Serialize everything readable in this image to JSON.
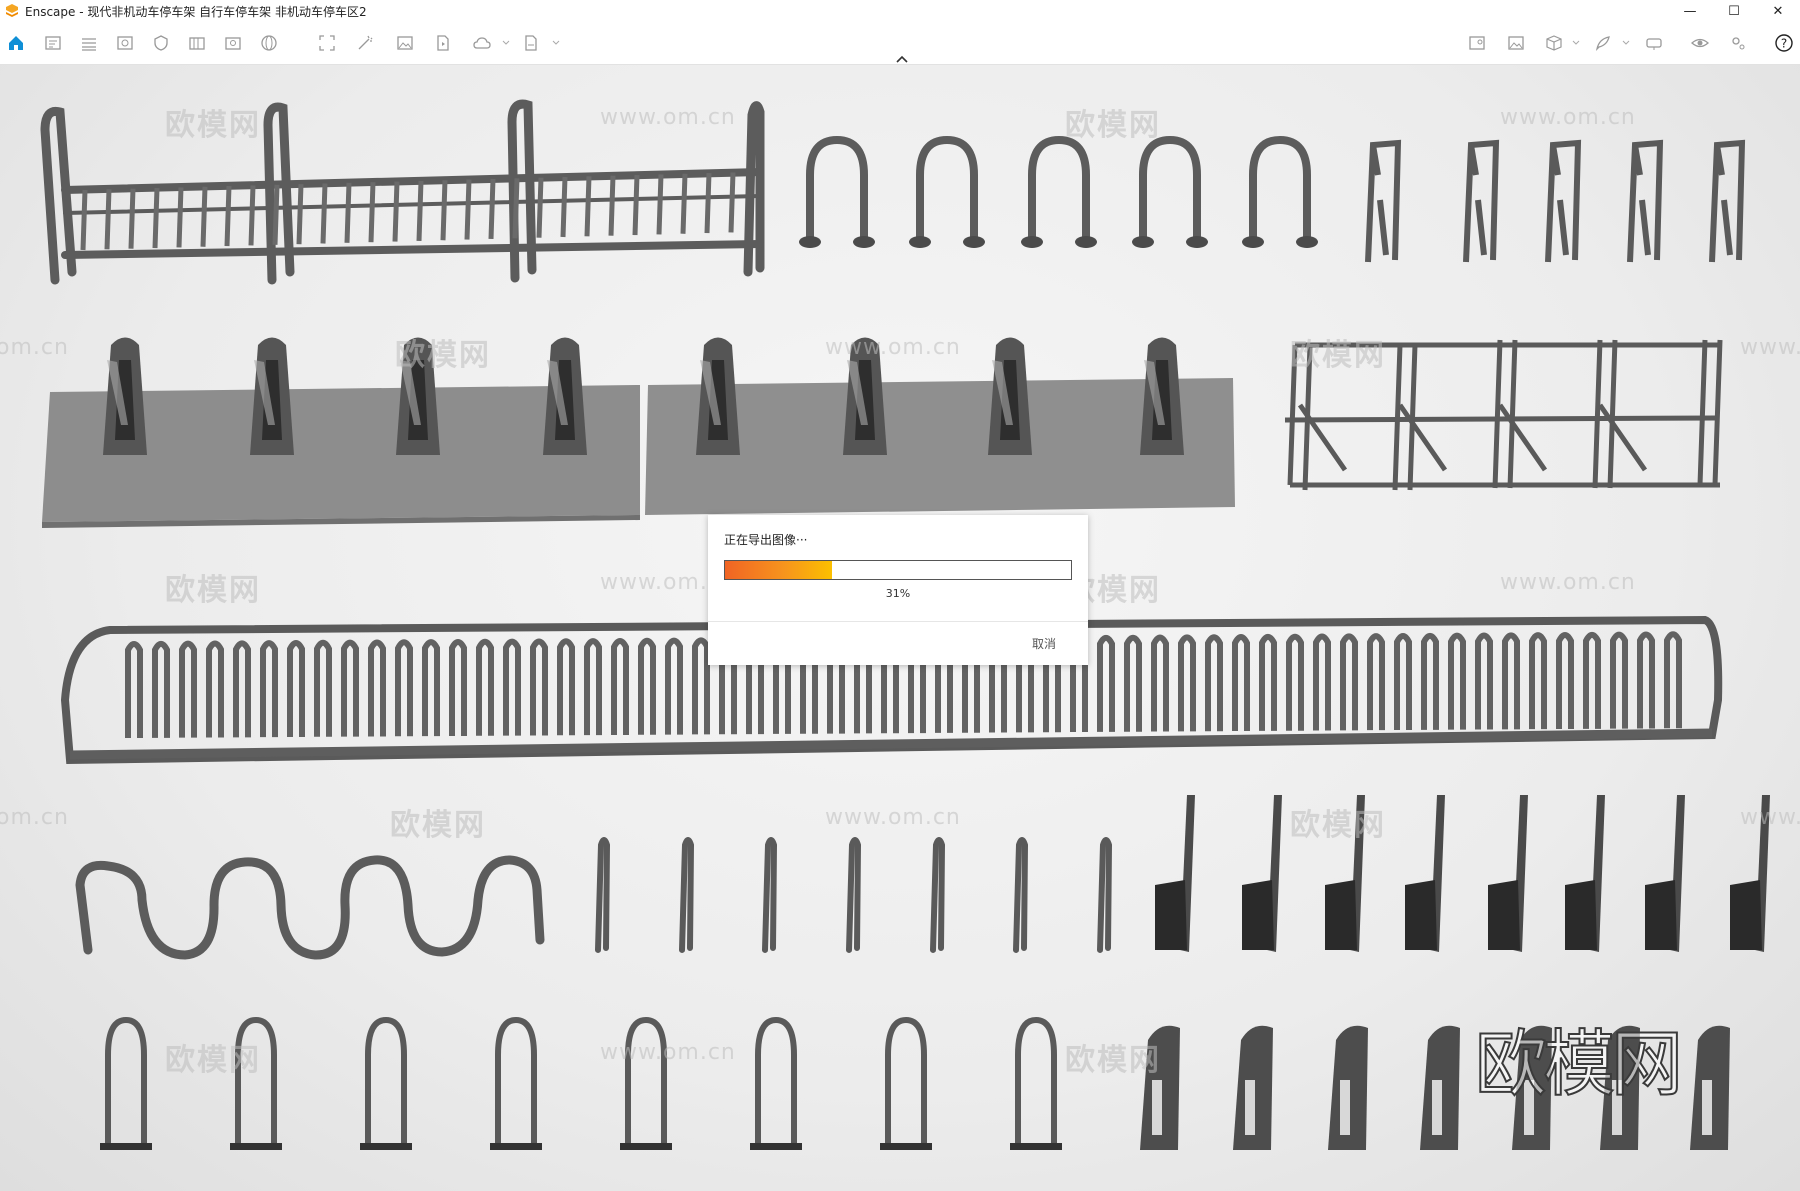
{
  "window": {
    "title": "Enscape - 现代非机动车停车架 自行车停车架 非机动车停车区2",
    "minimize_glyph": "—",
    "maximize_glyph": "☐",
    "close_glyph": "✕"
  },
  "toolbar": {
    "left_icons": [
      "home-icon",
      "screenshot-icon",
      "texture-icon",
      "eye-view-icon",
      "shield-icon",
      "batch-render-icon",
      "camera-save-icon",
      "panorama-icon",
      "export-frame-icon",
      "magic-wand-icon",
      "image-icon",
      "video-editor-icon",
      "cloud-upload-icon",
      "pdf-export-icon"
    ],
    "right_icons": [
      "map-icon",
      "image-preview-icon",
      "cube-icon",
      "feather-icon",
      "vr-headset-icon",
      "visibility-icon",
      "settings-icon",
      "help-icon"
    ]
  },
  "watermarks": {
    "brand_cn": "欧模网",
    "url": "www.om.cn",
    "url_partial": "om.cn",
    "url_partial_right": "www."
  },
  "export_dialog": {
    "title": "正在导出图像···",
    "progress": 0.31,
    "progress_label": "31%",
    "cancel_label": "取消"
  },
  "colors": {
    "accent_blue": "#0f8fd6",
    "logo_orange": "#f5a623",
    "progress_start": "#f06424",
    "progress_end": "#fcc000"
  }
}
